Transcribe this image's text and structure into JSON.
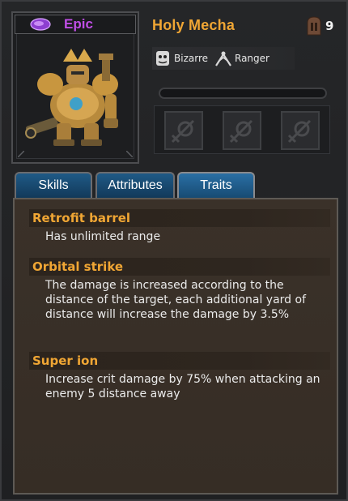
{
  "hero": {
    "rarity": "Epic",
    "name": "Holy Mecha",
    "level": "9",
    "tags": [
      {
        "label": "Bizarre",
        "icon": "bizarre-mask-icon"
      },
      {
        "label": "Ranger",
        "icon": "ranger-crossed-blades-icon"
      }
    ],
    "xp_progress": 0.0,
    "equipment_slots": [
      {
        "icon": "locked-weapon-slot-icon"
      },
      {
        "icon": "locked-weapon-slot-icon"
      },
      {
        "icon": "locked-weapon-slot-icon"
      }
    ]
  },
  "tabs": [
    {
      "label": "Skills",
      "active": false
    },
    {
      "label": "Attributes",
      "active": false
    },
    {
      "label": "Traits",
      "active": true
    }
  ],
  "traits": [
    {
      "name": "Retrofit barrel",
      "description": "Has unlimited range"
    },
    {
      "name": "Orbital strike",
      "description": "The damage is increased according to the distance of the target, each additional yard of distance will increase the damage by 3.5%"
    },
    {
      "name": "Super ion",
      "description": "Increase crit damage by 75% when attacking an enemy 5 distance away"
    }
  ],
  "colors": {
    "rarity_epic": "#c04ee6",
    "name_gold": "#f0a634",
    "tab_blue": "#1f5a86",
    "panel_brown": "#3a3129"
  }
}
